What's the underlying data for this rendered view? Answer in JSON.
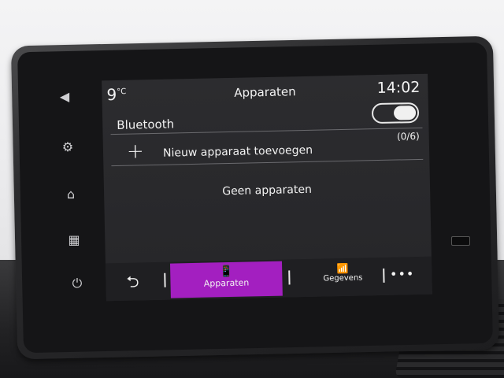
{
  "status": {
    "temperature": "9",
    "temperature_unit": "°C",
    "title": "Apparaten",
    "time": "14:02"
  },
  "bluetooth": {
    "label": "Bluetooth",
    "enabled": true
  },
  "add_device": {
    "icon": "+",
    "label": "Nieuw apparaat toevoegen",
    "count": "(0/6)"
  },
  "empty_message": "Geen apparaten",
  "bottom_bar": {
    "back_icon": "⮌",
    "tabs": [
      {
        "label": "Apparaten",
        "icon": "phone-icon",
        "glyph": "📱",
        "active": true
      },
      {
        "label": "Gegevens",
        "icon": "signal-icon",
        "glyph": "📶",
        "active": false
      }
    ],
    "more_icon": "•••"
  },
  "side_buttons": [
    {
      "icon": "volume-icon",
      "glyph": "◀"
    },
    {
      "icon": "car-settings-icon",
      "glyph": "⚙"
    },
    {
      "icon": "home-icon",
      "glyph": "⌂"
    },
    {
      "icon": "apps-grid-icon",
      "glyph": "▦"
    },
    {
      "icon": "power-icon",
      "glyph": "⏻"
    }
  ],
  "colors": {
    "accent": "#a31fc0",
    "screen_bg": "#2a2a2d",
    "text": "#f2f2f2"
  }
}
